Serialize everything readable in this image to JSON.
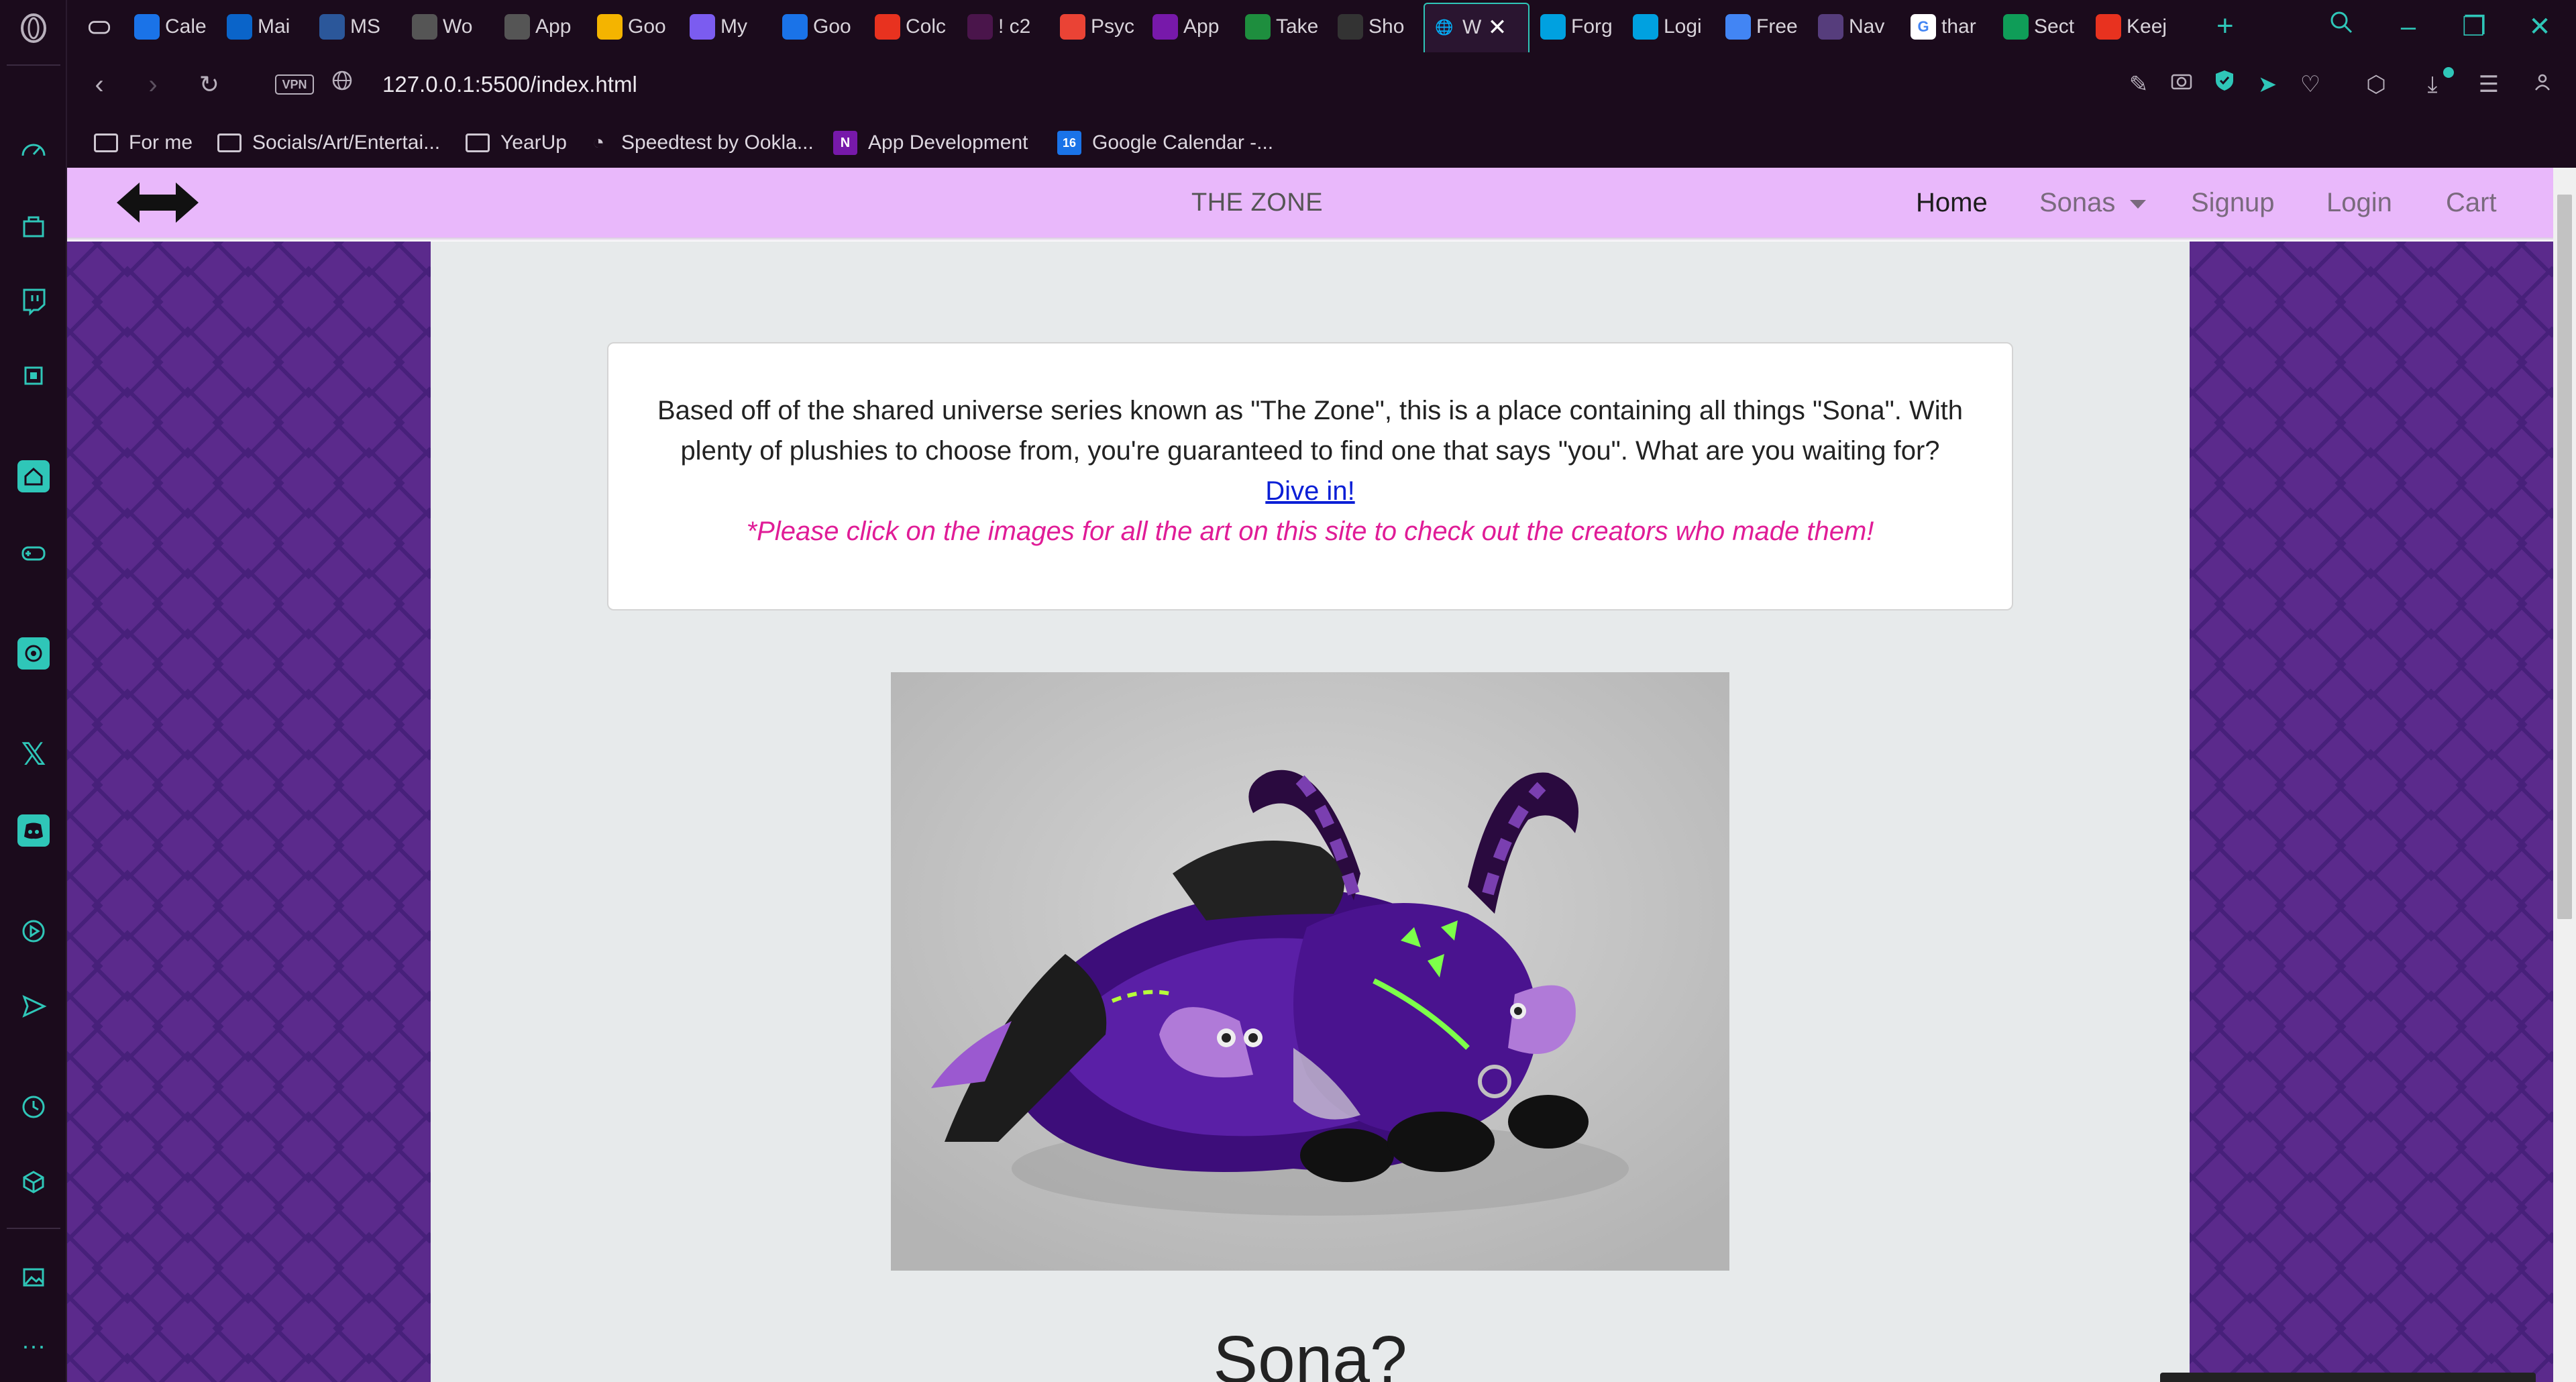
{
  "browser": {
    "tabs": [
      {
        "label": "Cale",
        "icon": "calendar-icon",
        "color": "#1a73e8"
      },
      {
        "label": "Mai",
        "icon": "outlook-icon",
        "color": "#0a64c9"
      },
      {
        "label": "MS",
        "icon": "word-icon",
        "color": "#2b579a"
      },
      {
        "label": "Wo",
        "icon": "s-circle-icon",
        "color": "#555555"
      },
      {
        "label": "App",
        "icon": "s-circle-icon",
        "color": "#555555"
      },
      {
        "label": "Goo",
        "icon": "keep-icon",
        "color": "#f4b400"
      },
      {
        "label": "My",
        "icon": "play-icon",
        "color": "#7b5cf0"
      },
      {
        "label": "Goo",
        "icon": "google-calendar-icon",
        "color": "#1a73e8"
      },
      {
        "label": "Colc",
        "icon": "record-icon",
        "color": "#e8321f"
      },
      {
        "label": "! c2",
        "icon": "slack-icon",
        "color": "#4a154b"
      },
      {
        "label": "Psyc",
        "icon": "gmail-icon",
        "color": "#ea4335"
      },
      {
        "label": "App",
        "icon": "onenote-icon",
        "color": "#7719aa"
      },
      {
        "label": "Take",
        "icon": "takeout-icon",
        "color": "#1e8e3e"
      },
      {
        "label": "Sho",
        "icon": "nu-icon",
        "color": "#333333"
      },
      {
        "label": "W",
        "icon": "globe-icon",
        "color": "#444444"
      },
      {
        "label": "Forg",
        "icon": "salesforce-icon",
        "color": "#00a1e0"
      },
      {
        "label": "Logi",
        "icon": "salesforce-icon",
        "color": "#00a1e0"
      },
      {
        "label": "Free",
        "icon": "forms-icon",
        "color": "#4285f4"
      },
      {
        "label": "Nav",
        "icon": "bootstrap-icon",
        "color": "#563d7c"
      },
      {
        "label": "thar",
        "icon": "google-icon",
        "color": "#ffffff"
      },
      {
        "label": "Sect",
        "icon": "plus-box-icon",
        "color": "#0f9d58"
      },
      {
        "label": "Keej",
        "icon": "asterisk-icon",
        "color": "#e8321f"
      }
    ],
    "active_tab_index": 14,
    "address": {
      "vpn_label": "VPN",
      "url": "127.0.0.1:5500/index.html"
    },
    "bookmarks": [
      {
        "label": "For me",
        "icon": "folder-icon"
      },
      {
        "label": "Socials/Art/Entertai...",
        "icon": "folder-icon"
      },
      {
        "label": "YearUp",
        "icon": "folder-icon"
      },
      {
        "label": "Speedtest by Ookla...",
        "icon": "speedometer-icon"
      },
      {
        "label": "App Development",
        "icon": "onenote-icon"
      },
      {
        "label": "Google Calendar -...",
        "icon": "google-calendar-icon"
      }
    ]
  },
  "site": {
    "title": "THE ZONE",
    "nav": {
      "home": "Home",
      "sonas": "Sonas",
      "signup": "Signup",
      "login": "Login",
      "cart": "Cart"
    },
    "intro": {
      "text": "Based off of the shared universe series known as \"The Zone\", this is a place containing all things \"Sona\". With plenty of plushies to choose from, you're guaranteed to find one that says \"you\". What are you waiting for?",
      "link": "Dive in!",
      "note": "*Please click on the images for all the art on this site to check out the creators who made them!"
    },
    "section_heading": "Sona?",
    "colors": {
      "nav_bg": "#e9b8fb",
      "side_panel": "#5b2a8c",
      "content_bg": "#e7eaeb",
      "note": "#e01c97",
      "link": "#0b1fd6"
    }
  }
}
